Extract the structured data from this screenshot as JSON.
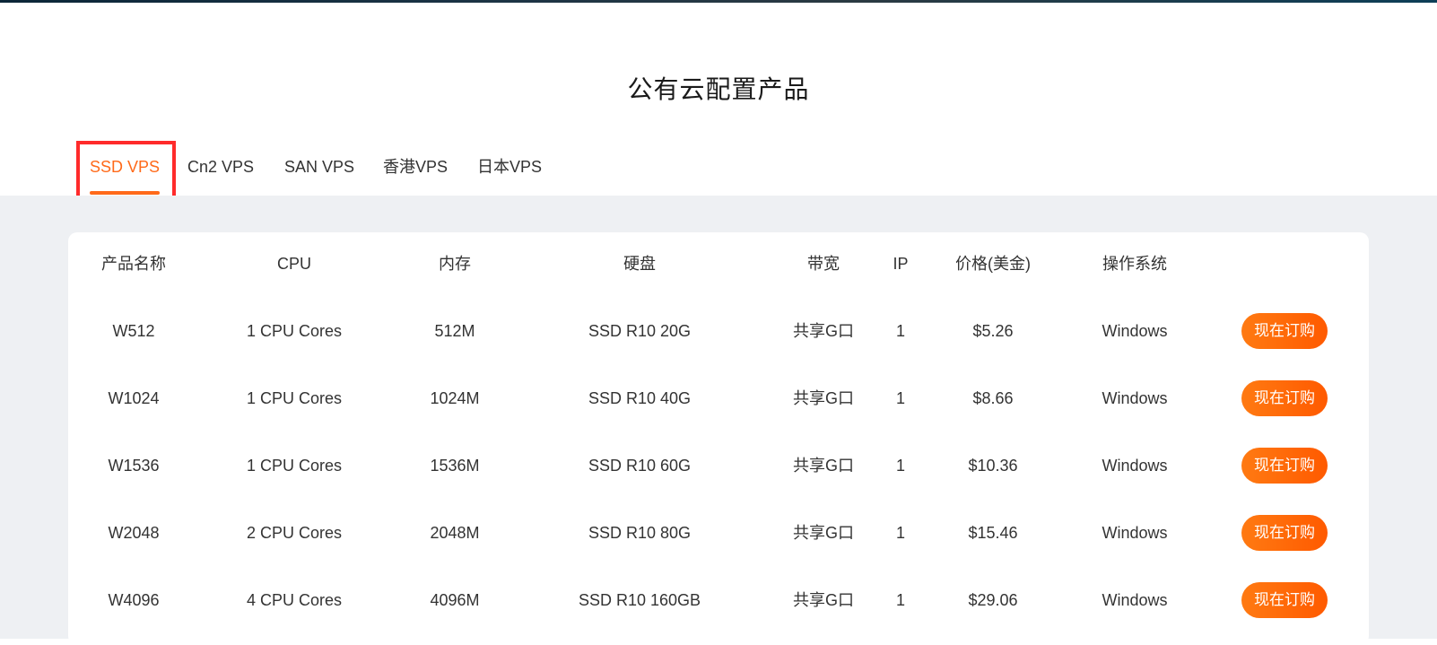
{
  "title": "公有云配置产品",
  "tabs": [
    {
      "label": "SSD VPS",
      "active": true
    },
    {
      "label": "Cn2 VPS",
      "active": false
    },
    {
      "label": "SAN VPS",
      "active": false
    },
    {
      "label": "香港VPS",
      "active": false
    },
    {
      "label": "日本VPS",
      "active": false
    }
  ],
  "table": {
    "headers": [
      "产品名称",
      "CPU",
      "内存",
      "硬盘",
      "带宽",
      "IP",
      "价格(美金)",
      "操作系统"
    ],
    "rows": [
      {
        "name": "W512",
        "cpu": "1 CPU Cores",
        "memory": "512M",
        "disk": "SSD R10 20G",
        "bandwidth": "共享G口",
        "ip": "1",
        "price": "$5.26",
        "os": "Windows",
        "action": "现在订购"
      },
      {
        "name": "W1024",
        "cpu": "1 CPU Cores",
        "memory": "1024M",
        "disk": "SSD R10 40G",
        "bandwidth": "共享G口",
        "ip": "1",
        "price": "$8.66",
        "os": "Windows",
        "action": "现在订购"
      },
      {
        "name": "W1536",
        "cpu": "1 CPU Cores",
        "memory": "1536M",
        "disk": "SSD R10 60G",
        "bandwidth": "共享G口",
        "ip": "1",
        "price": "$10.36",
        "os": "Windows",
        "action": "现在订购"
      },
      {
        "name": "W2048",
        "cpu": "2 CPU Cores",
        "memory": "2048M",
        "disk": "SSD R10 80G",
        "bandwidth": "共享G口",
        "ip": "1",
        "price": "$15.46",
        "os": "Windows",
        "action": "现在订购"
      },
      {
        "name": "W4096",
        "cpu": "4 CPU Cores",
        "memory": "4096M",
        "disk": "SSD R10 160GB",
        "bandwidth": "共享G口",
        "ip": "1",
        "price": "$29.06",
        "os": "Windows",
        "action": "现在订购"
      }
    ]
  },
  "colors": {
    "accent": "#ff6a1a",
    "highlight_border": "#ff2b2b",
    "section_background": "#eef0f3"
  }
}
